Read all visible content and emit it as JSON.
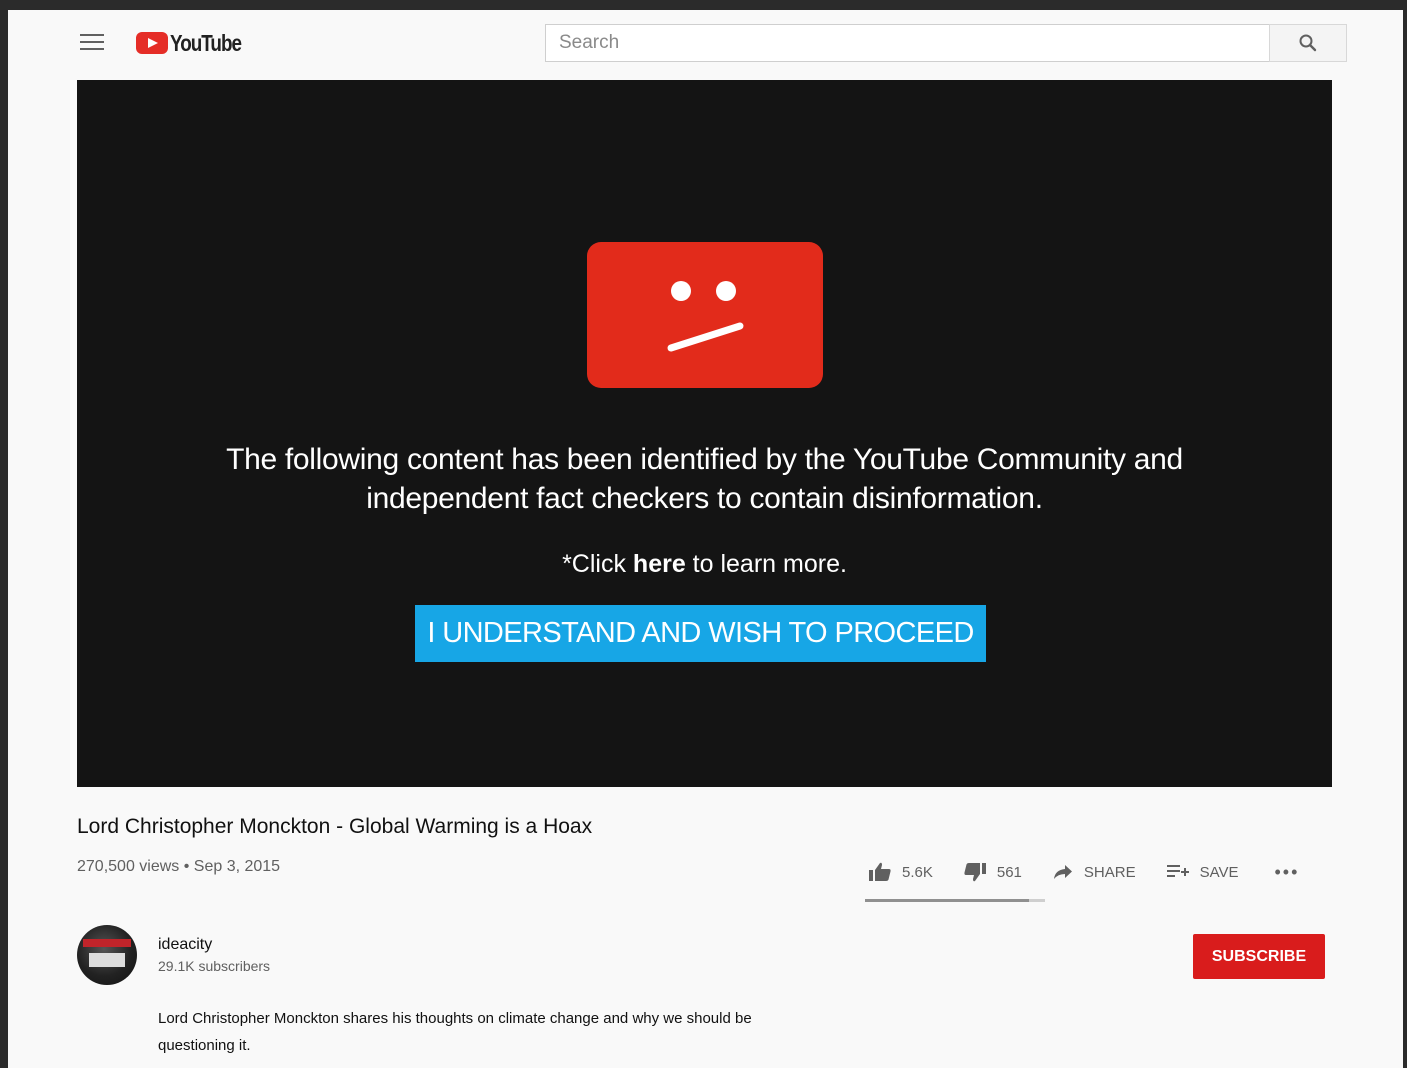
{
  "header": {
    "logo_text": "YouTube",
    "search_placeholder": "Search"
  },
  "player": {
    "message_line1": "The following content has been identified by the YouTube Community and",
    "message_line2": "independent fact checkers to contain disinformation.",
    "learn_more_prefix": "*Click ",
    "learn_more_link": "here",
    "learn_more_suffix": " to learn more.",
    "proceed_label": "I UNDERSTAND AND WISH TO PROCEED"
  },
  "video": {
    "title": "Lord Christopher Monckton - Global Warming is a Hoax",
    "meta": "270,500 views • Sep 3, 2015",
    "likes": "5.6K",
    "dislikes": "561",
    "share_label": "SHARE",
    "save_label": "SAVE",
    "more_label": "•••",
    "like_ratio": 0.91
  },
  "channel": {
    "name": "ideacity",
    "subscribers": "29.1K subscribers",
    "subscribe_label": "SUBSCRIBE"
  },
  "description": {
    "line1": "Lord Christopher Monckton shares his thoughts on climate change and why we should be",
    "line2": "questioning it."
  },
  "colors": {
    "brand_red": "#e52d27",
    "proceed_blue": "#17a6e6",
    "subscribe_red": "#d91c1c"
  },
  "icons": [
    "menu-icon",
    "youtube-logo-icon",
    "search-icon",
    "error-face-icon",
    "thumbs-up-icon",
    "thumbs-down-icon",
    "share-icon",
    "save-playlist-icon",
    "more-icon"
  ]
}
